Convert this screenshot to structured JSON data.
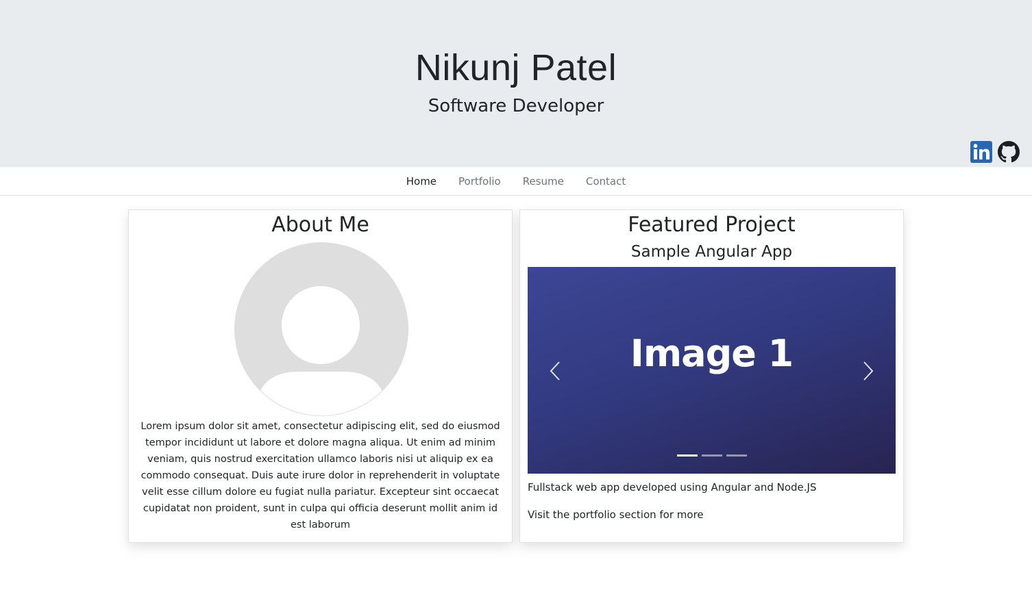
{
  "header": {
    "name": "Nikunj Patel",
    "role": "Software Developer",
    "social": [
      {
        "icon": "linkedin-icon",
        "color": "#2867b2"
      },
      {
        "icon": "github-icon",
        "color": "#1b1f23"
      }
    ]
  },
  "nav": {
    "items": [
      {
        "label": "Home",
        "active": true
      },
      {
        "label": "Portfolio",
        "active": false
      },
      {
        "label": "Resume",
        "active": false
      },
      {
        "label": "Contact",
        "active": false
      }
    ]
  },
  "about": {
    "title": "About Me",
    "avatar_icon": "default-user-avatar",
    "text": "Lorem ipsum dolor sit amet, consectetur adipiscing elit, sed do eiusmod tempor incididunt ut labore et dolore magna aliqua. Ut enim ad minim veniam, quis nostrud exercitation ullamco laboris nisi ut aliquip ex ea commodo consequat. Duis aute irure dolor in reprehenderit in voluptate velit esse cillum dolore eu fugiat nulla pariatur. Excepteur sint occaecat cupidatat non proident, sunt in culpa qui officia deserunt mollit anim id est laborum"
  },
  "featured": {
    "title": "Featured Project",
    "project_name": "Sample Angular App",
    "carousel": {
      "current_caption": "Image 1",
      "slide_count": 3,
      "active_index": 0
    },
    "description": "Fullstack web app developed using Angular and Node.JS",
    "more": "Visit the portfolio section for more"
  },
  "colors": {
    "jumbotron_bg": "#e9ecef",
    "carousel_start": "#3c4694",
    "carousel_end": "#282452",
    "linkedin": "#2867b2"
  }
}
